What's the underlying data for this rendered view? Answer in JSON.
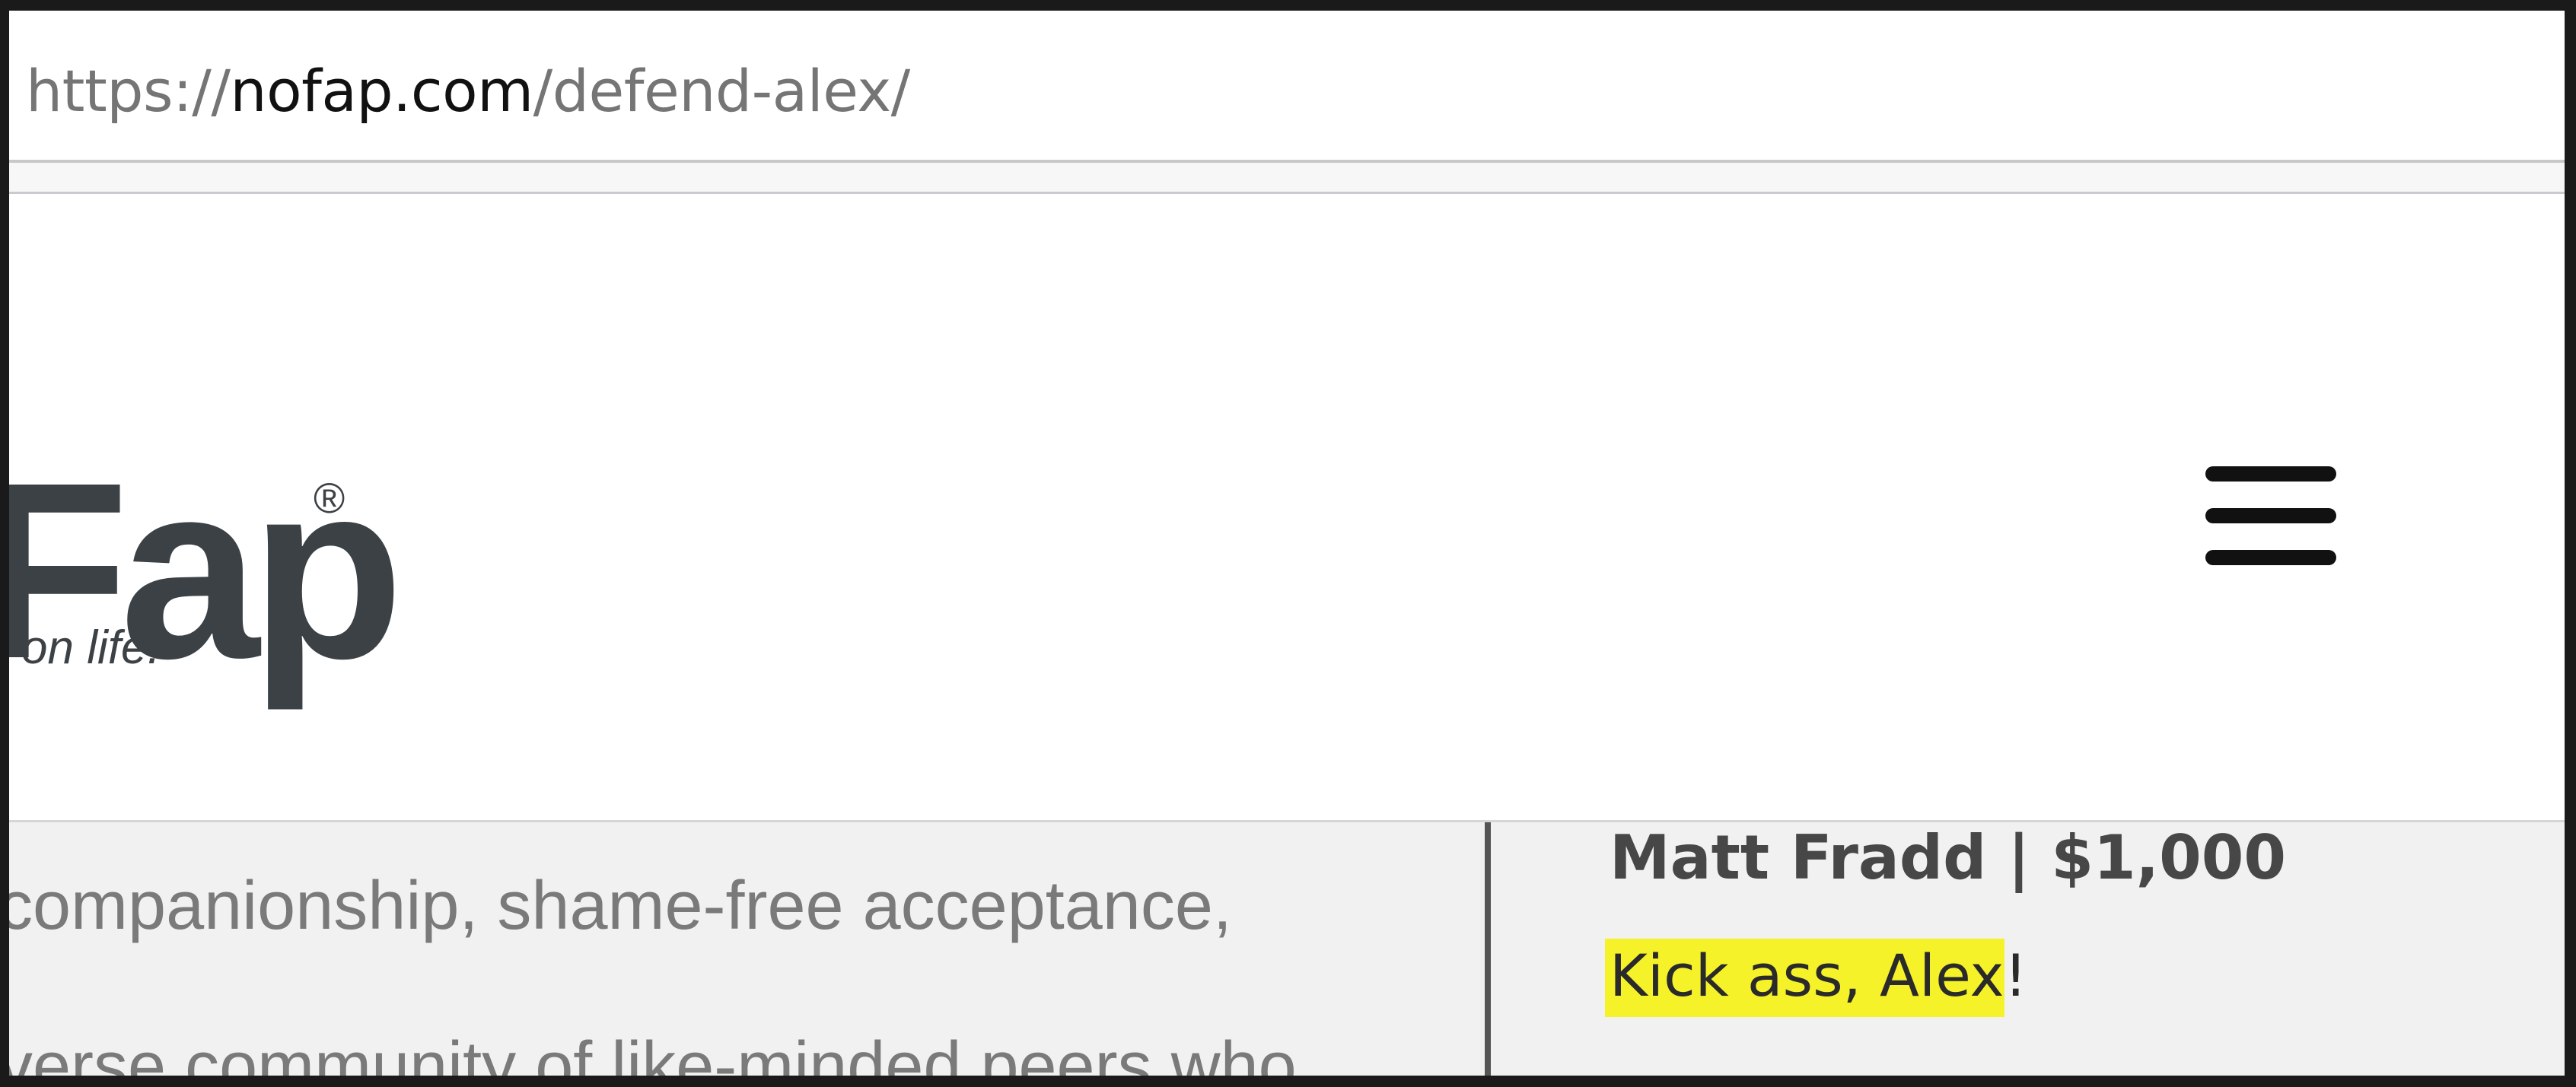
{
  "browser": {
    "url_prefix": "https://",
    "url_host": "nofap.com",
    "url_path": "/defend-alex/"
  },
  "header": {
    "logo_text": "Fap",
    "logo_registered": "®",
    "tagline": "on life.",
    "menu_icon": "hamburger-menu-icon"
  },
  "content": {
    "lines": [
      "companionship, shame-free acceptance,",
      "verse community of like-minded peers who"
    ],
    "donation": {
      "donor": "Matt Fradd | $1,000",
      "message_highlighted": "Kick ass, Alex",
      "message_tail": "!"
    }
  },
  "colors": {
    "highlight": "#f6f22a",
    "logo": "#3c4145",
    "content_bg": "#f1f1f1"
  }
}
